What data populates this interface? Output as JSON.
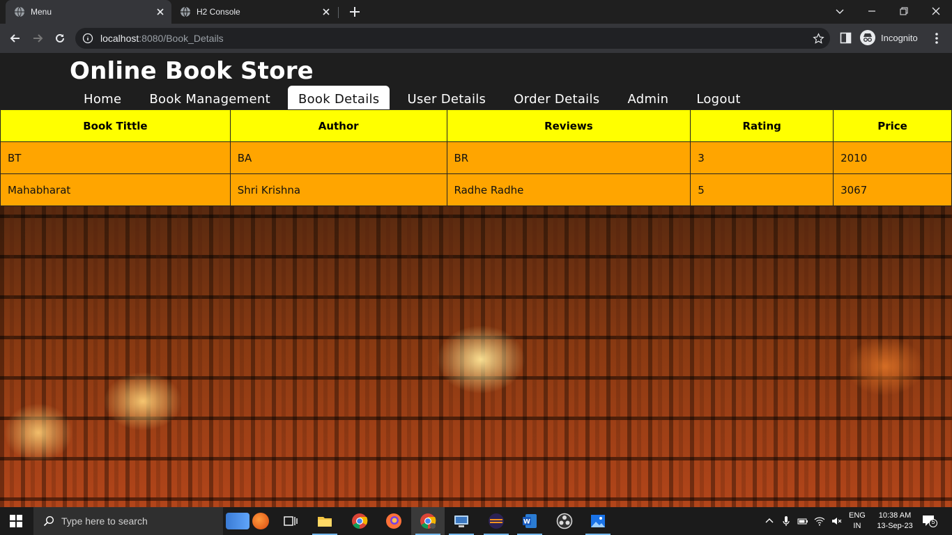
{
  "browser": {
    "tabs": [
      {
        "label": "Menu",
        "active": true
      },
      {
        "label": "H2 Console",
        "active": false
      }
    ],
    "url_host": "localhost",
    "url_rest": ":8080/Book_Details",
    "profile_label": "Incognito"
  },
  "site": {
    "title": "Online Book Store",
    "nav": [
      "Home",
      "Book Management",
      "Book Details",
      "User Details",
      "Order Details",
      "Admin",
      "Logout"
    ],
    "active_nav": "Book Details"
  },
  "table": {
    "headers": [
      "Book Tittle",
      "Author",
      "Reviews",
      "Rating",
      "Price"
    ],
    "rows": [
      [
        "BT",
        "BA",
        "BR",
        "3",
        "2010"
      ],
      [
        "Mahabharat",
        "Shri Krishna",
        "Radhe Radhe",
        "5",
        "3067"
      ]
    ]
  },
  "taskbar": {
    "search_placeholder": "Type here to search",
    "lang_line1": "ENG",
    "lang_line2": "IN",
    "time": "10:38 AM",
    "date": "13-Sep-23",
    "notification_count": "5"
  },
  "colors": {
    "header_bg": "#ffff00",
    "row_bg": "#ffa500",
    "page_header_bg": "#1e1e1e"
  }
}
